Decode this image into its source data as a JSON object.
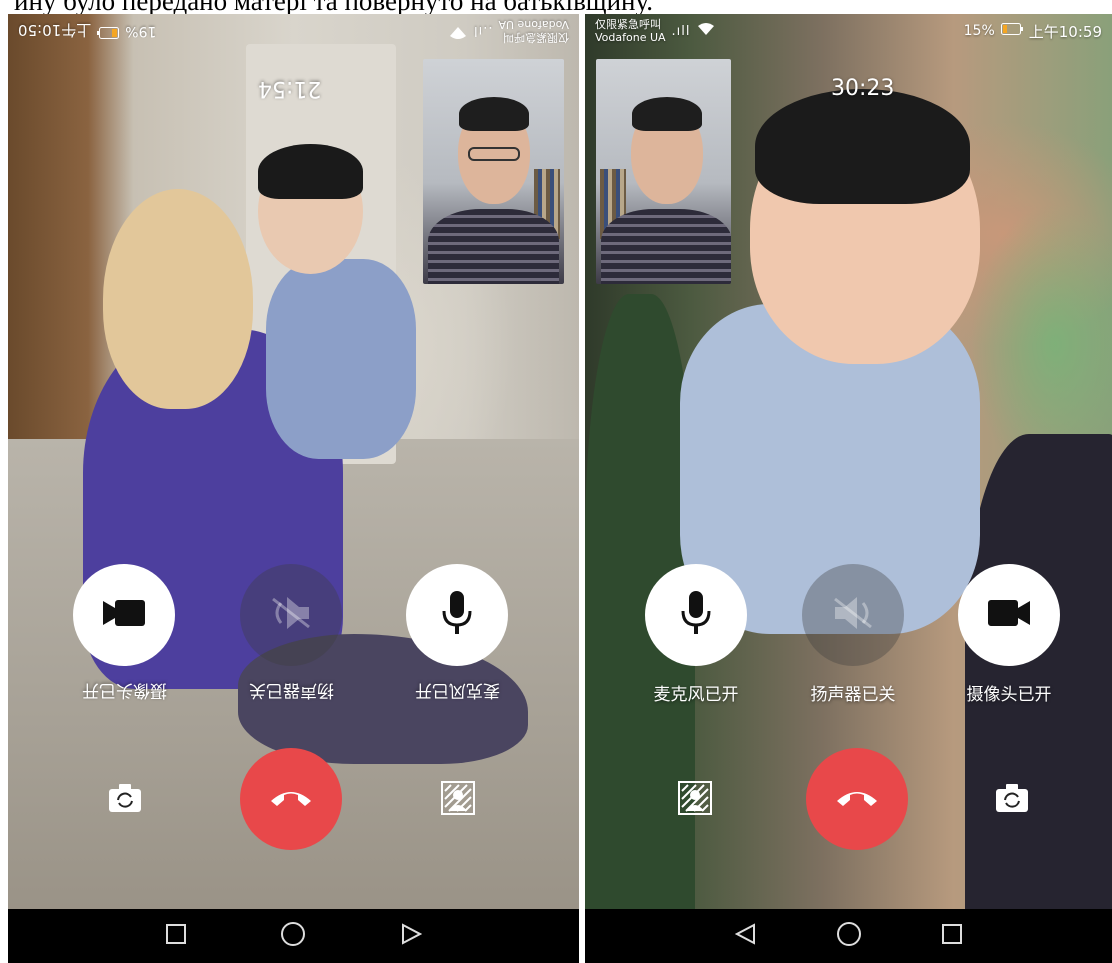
{
  "caption": "ину було передано матері та повернуто на батьківщину.",
  "left_phone": {
    "status": {
      "carrier_line1": "仅限紧急呼叫",
      "carrier_line2": "Vodafone UA",
      "signal": "..ıl",
      "battery": "19%",
      "time": "上午10:50"
    },
    "timer": "21:54",
    "controls": {
      "camera_label": "摄像头已开",
      "speaker_label": "扬声器已关",
      "mic_label": "麦克风已开"
    },
    "colors": {
      "hangup": "#e8484a",
      "button_on": "#ffffff",
      "button_off": "#3c3c3c"
    },
    "icons": [
      "video-camera-icon",
      "speaker-muted-icon",
      "microphone-icon",
      "switch-camera-icon",
      "hang-up-icon",
      "blur-background-icon",
      "recent-apps-icon",
      "home-icon",
      "back-icon"
    ]
  },
  "right_phone": {
    "status": {
      "carrier_line1": "仅限紧急呼叫",
      "carrier_line2": "Vodafone UA",
      "signal": ".ıll",
      "battery": "15%",
      "time": "上午10:59"
    },
    "timer": "30:23",
    "controls": {
      "mic_label": "麦克风已开",
      "speaker_label": "扬声器已关",
      "camera_label": "摄像头已开"
    },
    "colors": {
      "hangup": "#e8484a",
      "button_on": "#ffffff",
      "button_off": "#3c3c3c"
    },
    "icons": [
      "microphone-icon",
      "speaker-muted-icon",
      "video-camera-icon",
      "blur-background-icon",
      "hang-up-icon",
      "switch-camera-icon",
      "back-icon",
      "home-icon",
      "recent-apps-icon"
    ]
  }
}
